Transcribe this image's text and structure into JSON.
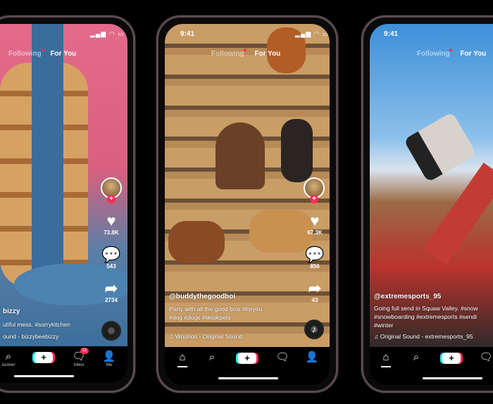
{
  "colors": {
    "accent": "#fe2c55",
    "accent_alt": "#25f4ee",
    "nav_bg": "#000000"
  },
  "phones": [
    {
      "status": {
        "time": "",
        "icons": "signal wifi battery"
      },
      "tabs": {
        "following": "Following",
        "for_you": "For You"
      },
      "rail": {
        "likes": "73.8K",
        "comments": "543",
        "shares": "2734"
      },
      "caption": {
        "user": "bizzy",
        "text": "utiful mess. #sorrykitchen",
        "sound": "ound - bizzybeebizzy"
      },
      "nav": {
        "discover": "iscover",
        "inbox": "Inbox",
        "inbox_badge": "11",
        "me": "Me"
      }
    },
    {
      "status": {
        "time": "9:41"
      },
      "tabs": {
        "following": "Following",
        "for_you": "For You"
      },
      "rail": {
        "likes": "67.3K",
        "comments": "856",
        "shares": "43"
      },
      "caption": {
        "user": "@buddythegoodboi",
        "line1": "Party with all the good bois #foryou",
        "line2": "#dog #dogs #tiktokpets",
        "sound": "Woohoo - Original Sound"
      }
    },
    {
      "status": {
        "time": "9:41"
      },
      "tabs": {
        "following": "Following",
        "for_you": "For You"
      },
      "caption": {
        "user": "@extremesports_95",
        "line1": "Going full send in Squaw Valley. #snow",
        "line2": "#snowboarding #extremesports #sendi",
        "line3": "#winter",
        "sound": "Original Sound - extremesports_95"
      }
    }
  ],
  "icons": {
    "like": "heart-icon",
    "comment": "comment-icon",
    "share": "share-icon",
    "music": "music-note-icon",
    "home": "home-icon",
    "search": "search-icon",
    "create": "plus-icon",
    "inbox": "inbox-icon",
    "me": "person-icon"
  }
}
